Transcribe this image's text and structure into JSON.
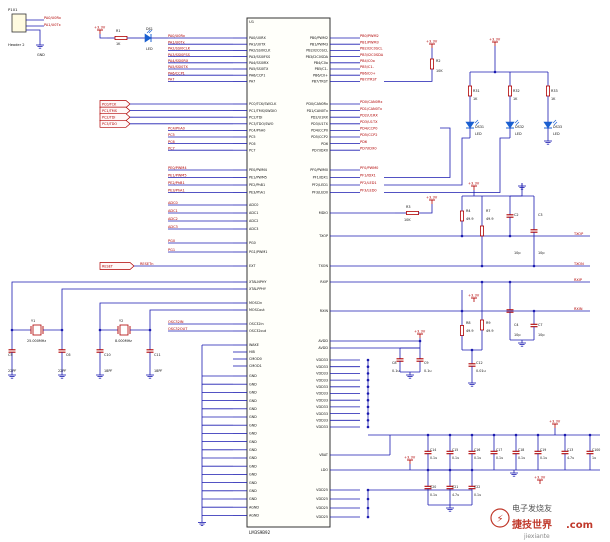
{
  "colors": {
    "wire": "#1a1ab0",
    "net_label": "#b00000",
    "pin_text": "#111111",
    "component": "#b00000",
    "power": "#b00000",
    "ground": "#1a1ab0",
    "chip_outline": "#333333",
    "led": "#1a5fd0"
  },
  "header": {
    "connector_ref": "P101",
    "connector_name": "Header 2",
    "pin1": "PA0/U0Rx",
    "pin2": "PA1/U0Tx",
    "gnd": "GND"
  },
  "led_top": {
    "vcc": "+3.3V",
    "res_ref": "R1",
    "res_val": "1K",
    "led_ref": "DS1",
    "led_val": "LED"
  },
  "chip": {
    "ref": "U1",
    "part": "LM3S9B92",
    "left_pins": [
      "PA0/U0RX",
      "PA1/U0TX",
      "PA2/SSI0CLK",
      "PA3/SSI0FSS",
      "PA4/SSI0RX",
      "PA5/SSI0TX",
      "PA6/CCP1",
      "PA7",
      "PC0/TCK/SWCLK",
      "PC1/TMS/SWDIO",
      "PC2/TDI",
      "PC3/TDO/SWO",
      "PC4/PhA0",
      "PC5",
      "PC6",
      "PC7",
      "PE0/PWM4",
      "PE1/PWM5",
      "PE2/PhB1",
      "PE3/PhA1",
      "ADC0",
      "ADC1",
      "ADC2",
      "ADC3",
      "PG0",
      "PG1/PWM1",
      "EXT",
      "XTALNPHY",
      "XTALPPHY",
      "MOSCin",
      "MOSCout",
      "OSC32in",
      "OSC32out",
      "WAKE",
      "HIB",
      "CMOD0",
      "CMOD1"
    ],
    "gnd_pins": [
      "GND",
      "GND",
      "GND",
      "GND",
      "GND",
      "GND",
      "GND",
      "GND",
      "GND",
      "GND",
      "GND",
      "GND",
      "GND",
      "GND",
      "GND",
      "GND",
      "AGND",
      "AGND"
    ],
    "right_pins": [
      "PB0/PWM2",
      "PB1/PWM3",
      "PB2/I2C0SCL",
      "PB3/I2C0SDA",
      "PB4/C0o",
      "PB5/C1-",
      "PB6/C0+",
      "PB7/TRST",
      "PD0/CAN0Rx",
      "PD1/CAN0Tx",
      "PD2/U1RX",
      "PD3/U1TX",
      "PD4/CCP0",
      "PD5/CCP2",
      "PD6",
      "PD7/IDX0",
      "PF0/PWM0",
      "PF1/IDX1",
      "PF2/LED1",
      "PF3/LED0",
      "MDIO",
      "TXOP",
      "TXON",
      "RXIP",
      "RXIN",
      "AVDD",
      "AVDD",
      "VDD33",
      "VDD33",
      "VDD33",
      "VDD33",
      "VDD33",
      "VDD33",
      "VDD33",
      "VDD33",
      "VDD33",
      "VDD33",
      "VDD33",
      "VBAT",
      "LDO",
      "VDD25",
      "VDD25",
      "VDD25",
      "VDD25"
    ]
  },
  "left_nets": {
    "pa": [
      "PA0/U0Rx",
      "PA1/U0Tx",
      "PA2/SSI0CLK",
      "PA3/SSI0FSS",
      "PA4/SSI0RX",
      "PA5/SSI0TX",
      "PA6/CCP1",
      "PA7"
    ],
    "pc_boxed": [
      "PC0/TCK",
      "PC1/TMS",
      "PC2/TDI",
      "PC3/TDO"
    ],
    "pc_plain": [
      "PC4/PhA0",
      "PC5",
      "PC6",
      "PC7"
    ],
    "pe": [
      "PE0/PWM4",
      "PE1/PWM5",
      "PE2/PhB1",
      "PE3/PhA1"
    ],
    "adc": [
      "ADC0",
      "ADC1",
      "ADC2",
      "ADC3"
    ],
    "pg": [
      "PG0",
      "PG1"
    ],
    "rst_box": "RESET",
    "rst_label": "RESETn",
    "osc": [
      "OSC32IN",
      "OSC32OUT"
    ]
  },
  "right_nets": {
    "pb": [
      "PB0/PWM2",
      "PB1/PWM3",
      "PB2/I2C0SCL",
      "PB3/I2C0SDA",
      "PB4/C0o",
      "PB5/C1-",
      "PB6/C0+",
      "PB7/TRST"
    ],
    "pd": [
      "PD0/CAN0Rx",
      "PD1/CAN0Tx",
      "PD2/U1RX",
      "PD3/U1TX",
      "PD4/CCP0",
      "PD5/CCP2",
      "PD6",
      "PD7/IDX0"
    ],
    "pf": [
      "PF0/PWM0",
      "PF1/IDX1",
      "PF2/LED1",
      "PF3/LED0"
    ],
    "eth": [
      "TXOP",
      "TXON",
      "RXIP",
      "RXIN"
    ]
  },
  "crystals": {
    "y1_ref": "Y1",
    "y1_val": "25.000MHz",
    "y2_ref": "Y2",
    "y2_val": "8.000MHz",
    "caps": [
      {
        "ref": "C5",
        "val": "22PF"
      },
      {
        "ref": "C6",
        "val": "22PF"
      },
      {
        "ref": "C10",
        "val": "18PF"
      },
      {
        "ref": "C11",
        "val": "18PF"
      }
    ]
  },
  "pullup": {
    "vcc": "+3.3V",
    "ref": "R2",
    "val": "10K"
  },
  "leds_right": [
    {
      "res": "R31",
      "rval": "1K",
      "led": "DS31",
      "lval": "LED"
    },
    {
      "res": "R32",
      "rval": "1K",
      "led": "DS32",
      "lval": "LED"
    },
    {
      "res": "R33",
      "rval": "1K",
      "led": "DS33",
      "lval": "LED"
    }
  ],
  "mdio": {
    "vcc": "+3.3V",
    "ref": "R3",
    "val": "10K"
  },
  "eth_top": {
    "vcc": "+3.3V",
    "r1_ref": "R4",
    "r1_val": "49.9",
    "r2_ref": "R7",
    "r2_val": "49.9",
    "c1_ref": "C2",
    "c1_val": "10p",
    "c2_ref": "C3",
    "c2_val": "10p"
  },
  "eth_bot": {
    "vcc": "+3.3V",
    "r1_ref": "R8",
    "r1_val": "49.9",
    "r2_ref": "R9",
    "r2_val": "49.9",
    "c1_ref": "C4",
    "c1_val": "10p",
    "c2_ref": "C7",
    "c2_val": "10p",
    "c3_ref": "C12",
    "c3_val": "0.01u"
  },
  "avdd": {
    "vcc": "+3.3V",
    "caps": [
      {
        "ref": "C8",
        "val": "0.1u"
      },
      {
        "ref": "C9",
        "val": "0.1u"
      }
    ]
  },
  "vdd33_caps": {
    "vcc": "+3.3V",
    "caps": [
      {
        "ref": "C14",
        "val": "0.1u"
      },
      {
        "ref": "C15",
        "val": "0.1u"
      },
      {
        "ref": "C16",
        "val": "0.1u"
      },
      {
        "ref": "C17",
        "val": "0.1u"
      },
      {
        "ref": "C18",
        "val": "0.1u"
      },
      {
        "ref": "C19",
        "val": "0.1u"
      },
      {
        "ref": "C13",
        "val": "4.7u"
      },
      {
        "ref": "C100",
        "val": "1u"
      }
    ]
  },
  "ldo_caps": {
    "vcc": "+3.3V",
    "caps": [
      {
        "ref": "C20",
        "val": "0.1u"
      },
      {
        "ref": "C21",
        "val": "4.7u"
      },
      {
        "ref": "C22",
        "val": "0.1u"
      }
    ]
  },
  "vdd25_vcc": "+3.3V",
  "watermark": {
    "line1": "电子发烧友",
    "line2": "捷技世界",
    "domain": ".com",
    "site": "jiexiante"
  }
}
